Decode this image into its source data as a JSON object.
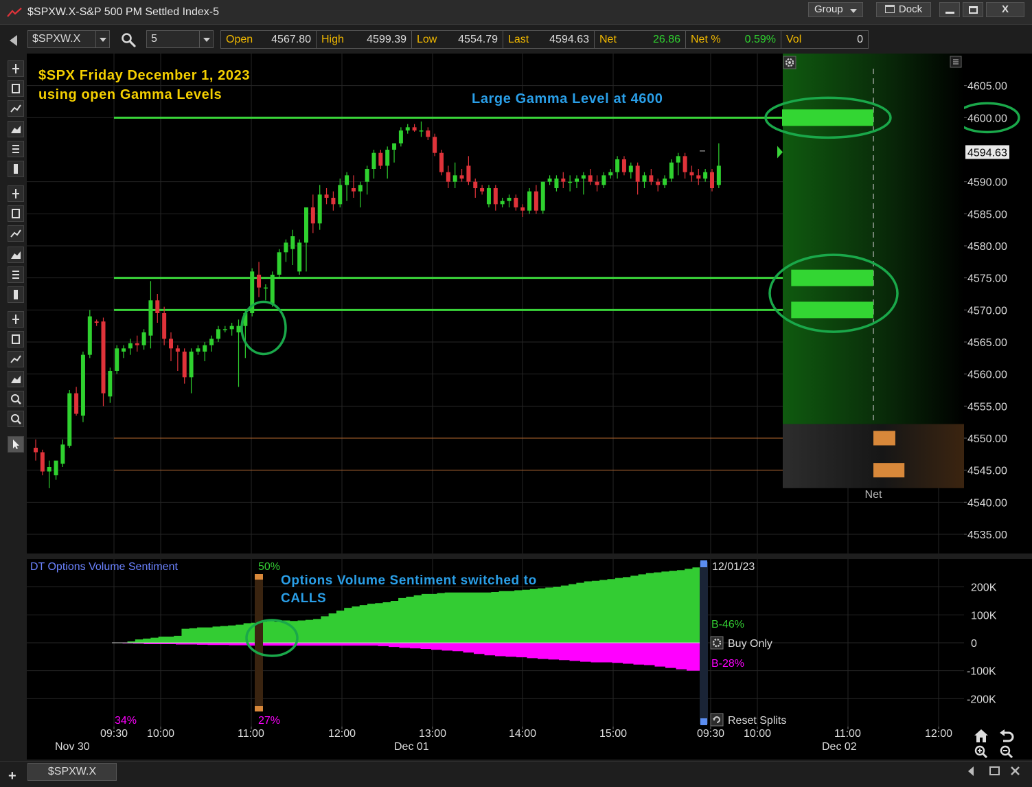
{
  "window": {
    "title": "$SPXW.X-S&P 500 PM Settled Index-5",
    "group_label": "Group",
    "dock_label": "Dock",
    "close_glyph": "X"
  },
  "toolbar": {
    "symbol": "$SPXW.X",
    "interval": "5",
    "quote": [
      {
        "label": "Open",
        "value": "4567.80",
        "tone": "neutral"
      },
      {
        "label": "High",
        "value": "4599.39",
        "tone": "neutral"
      },
      {
        "label": "Low",
        "value": "4554.79",
        "tone": "neutral"
      },
      {
        "label": "Last",
        "value": "4594.63",
        "tone": "neutral"
      },
      {
        "label": "Net",
        "value": "26.86",
        "tone": "positive"
      },
      {
        "label": "Net %",
        "value": "0.59%",
        "tone": "positive"
      },
      {
        "label": "Vol",
        "value": "0",
        "tone": "neutral"
      }
    ]
  },
  "colors": {
    "up": "#2fd12f",
    "down": "#e0333a",
    "gamma_line": "#3ad43a",
    "annotation_yellow": "#f5d000",
    "annotation_blue": "#2a9fe8",
    "calls": "#33cc33",
    "puts": "#ff00ff",
    "highlight_ring": "#1aa84a",
    "orange": "#d8883a"
  },
  "annotations": {
    "title_line1": "$SPX Friday December 1, 2023",
    "title_line2": "using open Gamma Levels",
    "gamma_note": "Large Gamma Level at 4600",
    "sentiment_note_line1": "Options Volume Sentiment switched to",
    "sentiment_note_line2": "CALLS"
  },
  "chart_data": {
    "type": "candlestick",
    "price_ticks": [
      "4605.00",
      "4600.00",
      "4594.63",
      "4590.00",
      "4585.00",
      "4580.00",
      "4575.00",
      "4570.00",
      "4565.00",
      "4560.00",
      "4555.00",
      "4550.00",
      "4545.00",
      "4540.00",
      "4535.00"
    ],
    "price_range": [
      4532,
      4610
    ],
    "last_price": 4594.63,
    "gamma_levels": [
      4600,
      4575,
      4570
    ],
    "minor_levels": [
      4550,
      4545
    ],
    "net_panel": {
      "label": "Net",
      "bars": [
        {
          "price": 4600,
          "tone": "green",
          "size": 1.0
        },
        {
          "price": 4575,
          "tone": "green",
          "size": 0.9
        },
        {
          "price": 4570,
          "tone": "green",
          "size": 0.9
        },
        {
          "price": 4550,
          "tone": "orange",
          "size": 0.24
        },
        {
          "price": 4545,
          "tone": "orange",
          "size": 0.34
        }
      ]
    },
    "candles": [
      [
        4548.5,
        4549.8,
        4546.5,
        4547.8
      ],
      [
        4547.8,
        4548.2,
        4544.2,
        4544.8
      ],
      [
        4544.8,
        4546.5,
        4542.2,
        4545.5
      ],
      [
        4544.2,
        4545.8,
        4543.5,
        4546.5
      ],
      [
        4546.0,
        4549.8,
        4545.5,
        4549.0
      ],
      [
        4548.8,
        4557.5,
        4548.5,
        4557.0
      ],
      [
        4557.0,
        4558.0,
        4553.5,
        4553.8
      ],
      [
        4553.5,
        4563.5,
        4552.5,
        4563.0
      ],
      [
        4563.0,
        4570.0,
        4562.5,
        4569.0
      ],
      [
        4568.2,
        4568.5,
        4567.5,
        4568.0
      ],
      [
        4568.2,
        4568.8,
        4555.0,
        4557.0
      ],
      [
        4556.5,
        4561.0,
        4555.5,
        4560.5
      ],
      [
        4560.5,
        4564.5,
        4560.0,
        4564.0
      ],
      [
        4563.5,
        4564.5,
        4562.5,
        4564.0
      ],
      [
        4564.0,
        4565.5,
        4563.0,
        4564.8
      ],
      [
        4564.8,
        4566.0,
        4563.5,
        4564.5
      ],
      [
        4564.5,
        4567.0,
        4563.8,
        4566.5
      ],
      [
        4566.0,
        4574.5,
        4564.0,
        4571.5
      ],
      [
        4571.5,
        4572.5,
        4568.0,
        4569.5
      ],
      [
        4569.5,
        4570.5,
        4564.5,
        4565.5
      ],
      [
        4565.5,
        4566.5,
        4562.0,
        4564.0
      ],
      [
        4564.0,
        4564.5,
        4560.5,
        4563.5
      ],
      [
        4563.5,
        4564.0,
        4558.5,
        4559.5
      ],
      [
        4559.5,
        4564.0,
        4557.0,
        4563.5
      ],
      [
        4563.5,
        4564.5,
        4563.0,
        4564.0
      ],
      [
        4563.5,
        4565.0,
        4562.0,
        4564.5
      ],
      [
        4564.5,
        4566.0,
        4563.5,
        4565.5
      ],
      [
        4565.5,
        4567.5,
        4565.0,
        4567.0
      ],
      [
        4567.0,
        4567.5,
        4566.5,
        4567.0
      ],
      [
        4567.0,
        4568.0,
        4566.0,
        4567.5
      ],
      [
        4566.5,
        4568.5,
        4558.0,
        4567.5
      ],
      [
        4567.5,
        4570.0,
        4562.5,
        4569.5
      ],
      [
        4569.5,
        4576.5,
        4569.0,
        4576.0
      ],
      [
        4575.5,
        4577.5,
        4572.0,
        4573.5
      ],
      [
        4573.5,
        4574.0,
        4571.5,
        4573.5
      ],
      [
        4571.0,
        4576.0,
        4570.5,
        4575.5
      ],
      [
        4575.5,
        4579.5,
        4575.0,
        4579.0
      ],
      [
        4579.0,
        4581.0,
        4577.5,
        4580.5
      ],
      [
        4579.5,
        4582.5,
        4577.0,
        4581.5
      ],
      [
        4576.0,
        4581.0,
        4575.5,
        4580.5
      ],
      [
        4580.5,
        4586.0,
        4576.0,
        4586.0
      ],
      [
        4586.0,
        4588.0,
        4582.0,
        4583.5
      ],
      [
        4583.5,
        4589.5,
        4582.5,
        4588.0
      ],
      [
        4588.0,
        4589.0,
        4586.5,
        4587.5
      ],
      [
        4587.5,
        4588.5,
        4585.5,
        4586.5
      ],
      [
        4586.5,
        4590.5,
        4586.0,
        4589.5
      ],
      [
        4589.5,
        4591.5,
        4587.0,
        4591.0
      ],
      [
        4589.0,
        4591.0,
        4587.5,
        4588.5
      ],
      [
        4588.5,
        4590.0,
        4586.0,
        4589.5
      ],
      [
        4590.0,
        4592.5,
        4588.0,
        4592.0
      ],
      [
        4592.0,
        4595.0,
        4590.5,
        4594.5
      ],
      [
        4594.5,
        4595.0,
        4592.0,
        4592.5
      ],
      [
        4592.5,
        4595.5,
        4590.5,
        4595.0
      ],
      [
        4595.0,
        4596.0,
        4593.0,
        4596.0
      ],
      [
        4596.0,
        4598.5,
        4595.5,
        4598.0
      ],
      [
        4598.0,
        4599.0,
        4597.5,
        4598.5
      ],
      [
        4598.5,
        4599.0,
        4597.8,
        4598.0
      ],
      [
        4598.0,
        4599.4,
        4597.0,
        4598.0
      ],
      [
        4598.0,
        4598.5,
        4596.5,
        4597.0
      ],
      [
        4597.0,
        4597.5,
        4594.0,
        4594.5
      ],
      [
        4594.5,
        4595.0,
        4591.0,
        4591.5
      ],
      [
        4591.5,
        4592.5,
        4589.0,
        4590.0
      ],
      [
        4590.0,
        4593.0,
        4589.0,
        4591.0
      ],
      [
        4591.0,
        4592.0,
        4590.0,
        4590.5
      ],
      [
        4592.5,
        4594.0,
        4589.5,
        4590.0
      ],
      [
        4590.0,
        4590.5,
        4587.5,
        4589.0
      ],
      [
        4589.0,
        4589.5,
        4588.0,
        4588.5
      ],
      [
        4586.5,
        4589.5,
        4586.0,
        4589.0
      ],
      [
        4589.0,
        4589.5,
        4585.5,
        4586.5
      ],
      [
        4586.5,
        4587.5,
        4586.0,
        4587.0
      ],
      [
        4587.0,
        4588.0,
        4586.0,
        4587.5
      ],
      [
        4587.5,
        4588.0,
        4585.5,
        4586.0
      ],
      [
        4586.0,
        4586.5,
        4584.5,
        4585.5
      ],
      [
        4585.5,
        4589.0,
        4585.0,
        4588.5
      ],
      [
        4588.5,
        4589.5,
        4585.0,
        4585.5
      ],
      [
        4585.5,
        4590.0,
        4585.0,
        4590.0
      ],
      [
        4590.0,
        4591.0,
        4589.5,
        4590.5
      ],
      [
        4589.0,
        4591.0,
        4588.5,
        4590.5
      ],
      [
        4590.5,
        4591.5,
        4589.0,
        4590.0
      ],
      [
        4590.0,
        4591.0,
        4588.5,
        4590.0
      ],
      [
        4590.0,
        4591.0,
        4589.0,
        4590.5
      ],
      [
        4590.5,
        4591.5,
        4588.0,
        4591.0
      ],
      [
        4591.0,
        4592.0,
        4589.5,
        4590.0
      ],
      [
        4590.0,
        4591.0,
        4588.5,
        4589.5
      ],
      [
        4589.5,
        4591.5,
        4589.0,
        4591.0
      ],
      [
        4591.0,
        4592.0,
        4590.5,
        4591.5
      ],
      [
        4591.5,
        4594.0,
        4590.5,
        4593.5
      ],
      [
        4593.5,
        4594.0,
        4591.0,
        4591.5
      ],
      [
        4591.5,
        4593.0,
        4590.5,
        4592.5
      ],
      [
        4592.5,
        4593.0,
        4588.0,
        4590.0
      ],
      [
        4590.0,
        4591.5,
        4589.0,
        4591.0
      ],
      [
        4591.0,
        4592.0,
        4589.5,
        4590.0
      ],
      [
        4590.0,
        4590.5,
        4588.5,
        4589.5
      ],
      [
        4589.5,
        4591.0,
        4589.0,
        4590.5
      ],
      [
        4590.5,
        4593.5,
        4590.0,
        4593.0
      ],
      [
        4593.0,
        4594.5,
        4591.0,
        4594.0
      ],
      [
        4594.0,
        4594.5,
        4590.5,
        4591.5
      ],
      [
        4591.5,
        4592.5,
        4590.0,
        4591.0
      ],
      [
        4591.0,
        4592.0,
        4589.5,
        4590.5
      ],
      [
        4590.5,
        4592.0,
        4590.0,
        4591.5
      ],
      [
        4591.5,
        4592.0,
        4588.5,
        4589.0
      ],
      [
        4589.5,
        4596.0,
        4589.0,
        4592.5
      ]
    ],
    "session_breaks": [
      0,
      8,
      101
    ],
    "time_labels": [
      "09:30",
      "10:00",
      "11:00",
      "12:00",
      "13:00",
      "14:00",
      "15:00",
      "09:30",
      "10:00",
      "11:00",
      "12:00"
    ],
    "date_labels": [
      "Nov 30",
      "Dec 01",
      "Dec 02"
    ]
  },
  "indicator": {
    "title": "DT Options Volume Sentiment",
    "split_top_pct": "50%",
    "split_bottom_pct": "27%",
    "left_bottom_pct": "34%",
    "date_label": "12/01/23",
    "calls_label": "B-46%",
    "puts_label": "B-28%",
    "buy_only_label": "Buy Only",
    "reset_label": "Reset Splits",
    "ticks": [
      "200K",
      "100K",
      "0",
      "-100K",
      "-200K"
    ],
    "range": [
      -300000,
      300000
    ],
    "calls_values": [
      1000,
      1000,
      5000,
      12000,
      15000,
      18000,
      22000,
      22000,
      25000,
      50000,
      52000,
      55000,
      55000,
      58000,
      60000,
      62000,
      65000,
      70000,
      72000,
      75000,
      78000,
      75000,
      80000,
      78000,
      80000,
      82000,
      85000,
      95000,
      105000,
      115000,
      125000,
      130000,
      135000,
      140000,
      142000,
      145000,
      150000,
      160000,
      165000,
      170000,
      175000,
      175000,
      178000,
      180000,
      180000,
      180000,
      180000,
      180000,
      180000,
      182000,
      185000,
      185000,
      188000,
      190000,
      192000,
      195000,
      198000,
      200000,
      205000,
      210000,
      215000,
      220000,
      222000,
      225000,
      228000,
      232000,
      235000,
      240000,
      245000,
      250000,
      252000,
      255000,
      258000,
      260000,
      265000,
      270000,
      280000
    ],
    "puts_values": [
      -1000,
      -2000,
      -3000,
      -5000,
      -5000,
      -5000,
      -6000,
      -6000,
      -7000,
      -8000,
      -8000,
      -9000,
      -9000,
      -10000,
      -10000,
      -10000,
      -10000,
      -10000,
      -10000,
      -10000,
      -10000,
      -10000,
      -10000,
      -10000,
      -10000,
      -12000,
      -15000,
      -18000,
      -20000,
      -22000,
      -25000,
      -28000,
      -30000,
      -35000,
      -40000,
      -45000,
      -48000,
      -50000,
      -52000,
      -55000,
      -58000,
      -60000,
      -62000,
      -65000,
      -68000,
      -70000,
      -70000,
      -72000,
      -75000,
      -78000,
      -80000,
      -85000,
      -90000,
      -95000,
      -100000,
      -100000
    ]
  }
}
